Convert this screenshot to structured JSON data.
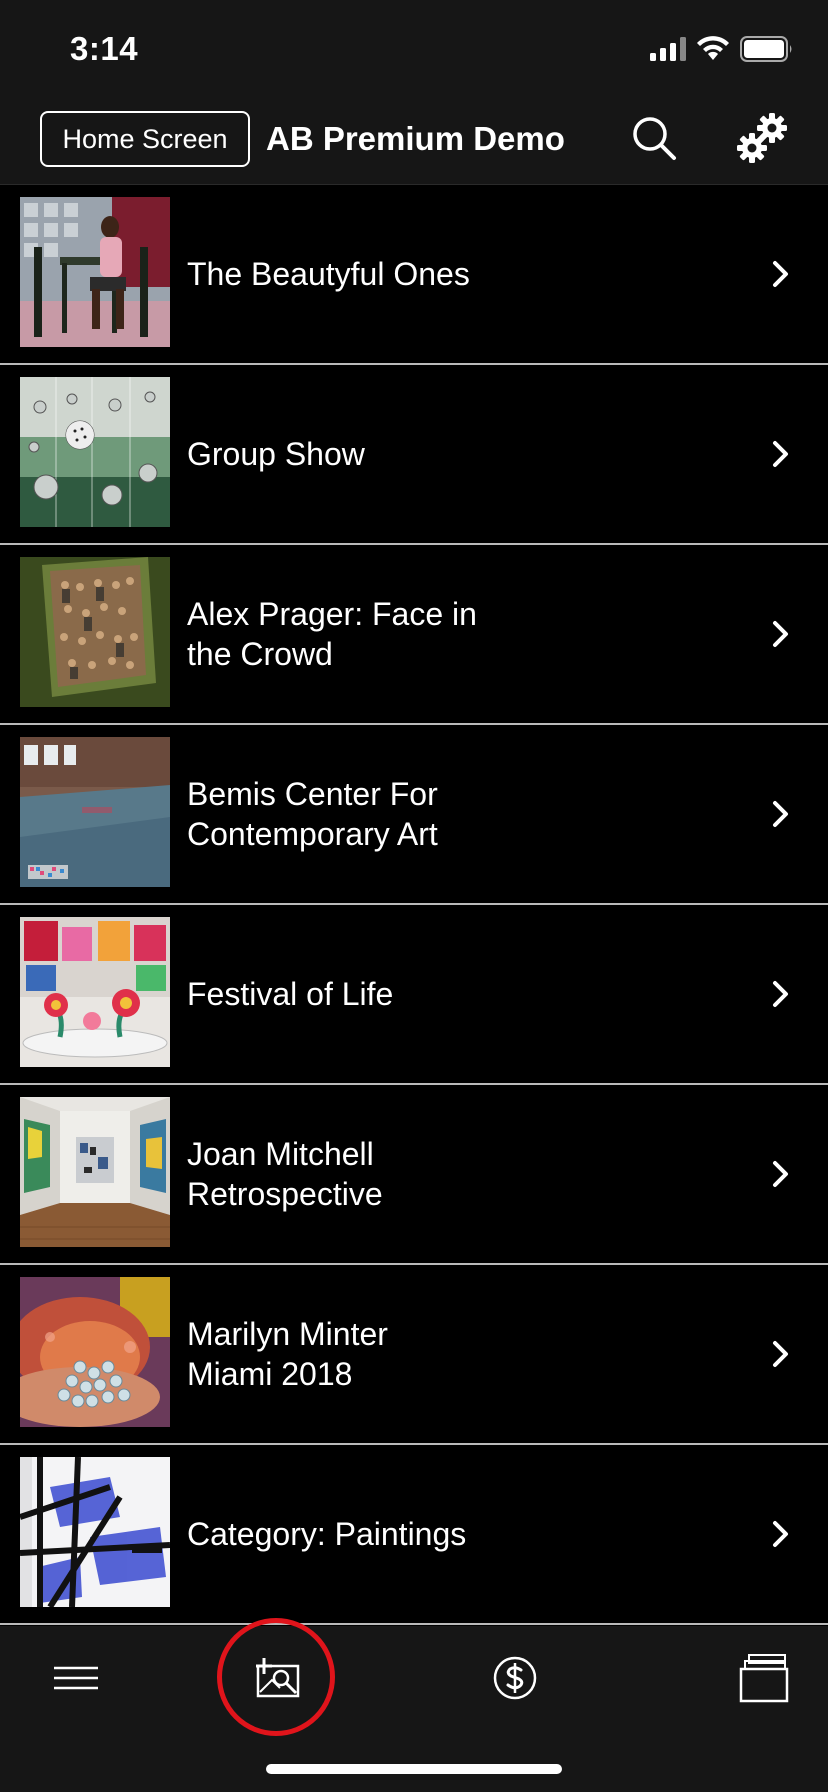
{
  "status_bar": {
    "time": "3:14",
    "icons": [
      "cellular-signal-icon",
      "wifi-icon",
      "battery-icon"
    ]
  },
  "header": {
    "home_button_label": "Home Screen",
    "title": "AB Premium Demo",
    "search_icon": "search-icon",
    "settings_icon": "gears-icon"
  },
  "list": {
    "items": [
      {
        "label": "The Beautyful Ones",
        "thumbnail": "painting-figure-thumbnail"
      },
      {
        "label": "Group Show",
        "thumbnail": "mirror-spheres-installation-thumbnail"
      },
      {
        "label": "Alex Prager: Face in\nthe Crowd",
        "thumbnail": "crowd-photo-thumbnail"
      },
      {
        "label": "Bemis Center For\nContemporary Art",
        "thumbnail": "gallery-floor-thumbnail"
      },
      {
        "label": "Festival of Life",
        "thumbnail": "flower-sculpture-thumbnail"
      },
      {
        "label": "Joan Mitchell\nRetrospective",
        "thumbnail": "gallery-room-thumbnail"
      },
      {
        "label": "Marilyn Minter\nMiami 2018",
        "thumbnail": "glitter-closeup-thumbnail"
      },
      {
        "label": "Category: Paintings",
        "thumbnail": "abstract-painting-thumbnail"
      }
    ],
    "chevron_icon": "chevron-right-icon"
  },
  "tab_bar": {
    "tabs": [
      {
        "icon": "menu-icon"
      },
      {
        "icon": "add-photo-icon",
        "highlighted": true
      },
      {
        "icon": "dollar-circle-icon"
      },
      {
        "icon": "folders-icon"
      }
    ],
    "highlight_color": "#e0141b"
  },
  "colors": {
    "background": "#000000",
    "bar_background": "#161616",
    "separator": "#b9b9b9",
    "text": "#ffffff"
  }
}
